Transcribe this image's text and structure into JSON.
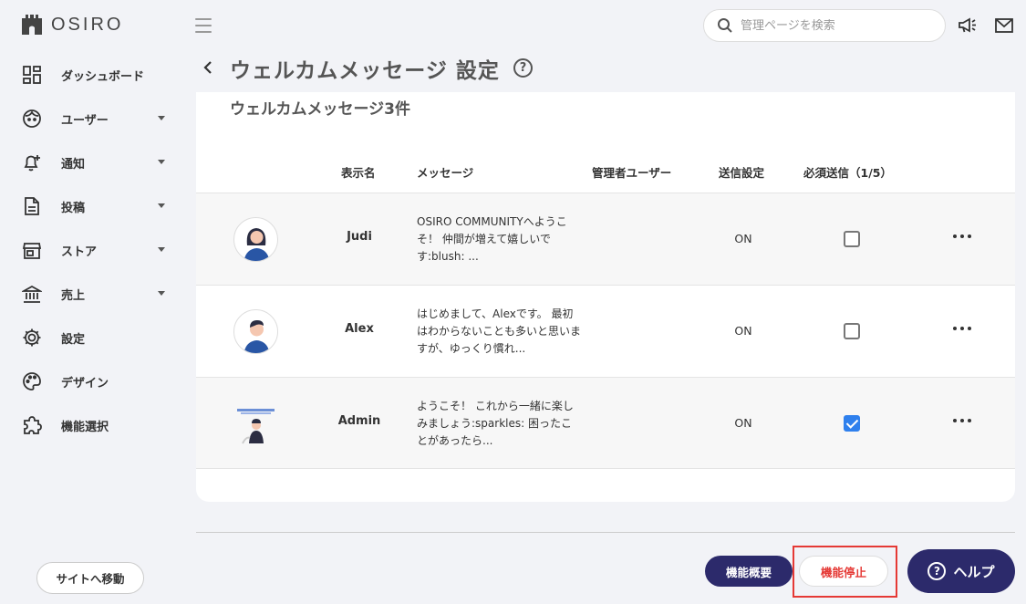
{
  "app": {
    "logo_text": "OSIRO"
  },
  "sidebar": {
    "items": [
      {
        "label": "ダッシュボード",
        "icon": "dashboard-icon",
        "has_caret": false
      },
      {
        "label": "ユーザー",
        "icon": "user-face-icon",
        "has_caret": true
      },
      {
        "label": "通知",
        "icon": "bell-plus-icon",
        "has_caret": true
      },
      {
        "label": "投稿",
        "icon": "document-icon",
        "has_caret": true
      },
      {
        "label": "ストア",
        "icon": "store-icon",
        "has_caret": true
      },
      {
        "label": "売上",
        "icon": "bank-icon",
        "has_caret": true
      },
      {
        "label": "設定",
        "icon": "gear-icon",
        "has_caret": false
      },
      {
        "label": "デザイン",
        "icon": "palette-icon",
        "has_caret": false
      },
      {
        "label": "機能選択",
        "icon": "puzzle-icon",
        "has_caret": false
      }
    ],
    "site_button": "サイトへ移動"
  },
  "header": {
    "search_placeholder": "管理ページを検索"
  },
  "page": {
    "title": "ウェルカムメッセージ 設定",
    "help_mark": "?",
    "count_label": "ウェルカムメッセージ3件"
  },
  "table": {
    "headers": [
      "表示名",
      "メッセージ",
      "管理者ユーザー",
      "送信設定",
      "必須送信（1/5）"
    ],
    "rows": [
      {
        "name": "Judi",
        "message": "OSIRO COMMUNITYへようこそ！ 仲間が増えて嬉しいです:blush: ...",
        "admin_user": "",
        "send_setting": "ON",
        "required": false
      },
      {
        "name": "Alex",
        "message": "はじめまして、Alexです。 最初はわからないことも多いと思いますが、ゆっくり慣れ...",
        "admin_user": "",
        "send_setting": "ON",
        "required": false
      },
      {
        "name": "Admin",
        "message": "ようこそ！ これから一緒に楽しみましょう:sparkles: 困ったことがあったら...",
        "admin_user": "",
        "send_setting": "ON",
        "required": true
      }
    ]
  },
  "footer": {
    "overview_button": "機能概要",
    "stop_button": "機能停止",
    "help_button": "ヘルプ",
    "help_mark": "?"
  },
  "colors": {
    "primary": "#2c2a6b",
    "danger": "#e53935",
    "checkbox_on": "#2f80ed",
    "background": "#f2f3f7"
  }
}
